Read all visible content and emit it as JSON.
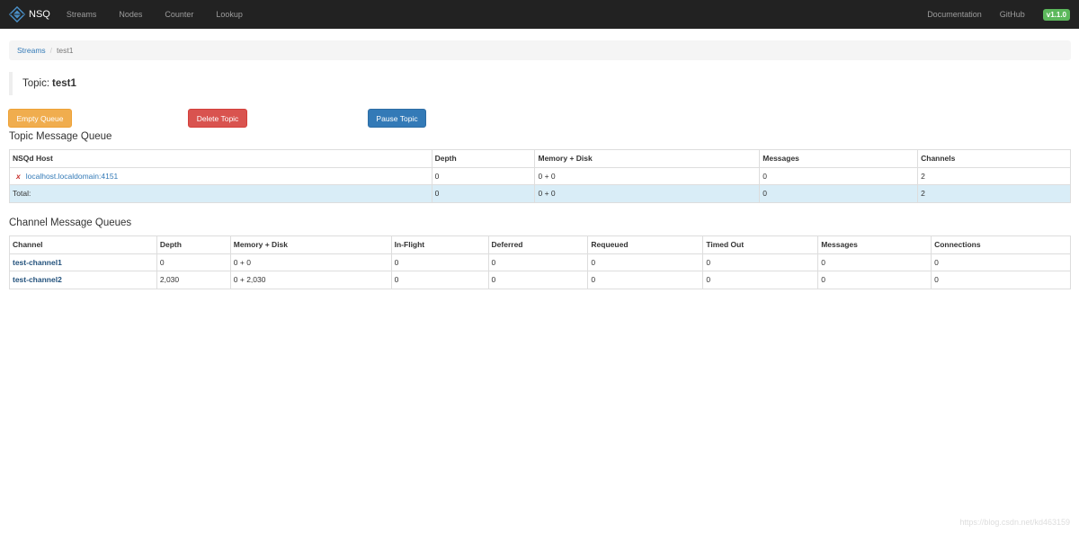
{
  "navbar": {
    "brand": "NSQ",
    "links": [
      "Streams",
      "Nodes",
      "Counter",
      "Lookup"
    ],
    "right_links": [
      "Documentation",
      "GitHub"
    ],
    "version": "v1.1.0"
  },
  "breadcrumb": {
    "parent": "Streams",
    "separator": "/",
    "current": "test1"
  },
  "topic": {
    "label": "Topic:",
    "name": "test1"
  },
  "buttons": {
    "empty_queue": "Empty Queue",
    "delete_topic": "Delete Topic",
    "pause_topic": "Pause Topic"
  },
  "topic_queue": {
    "title": "Topic Message Queue",
    "headers": [
      "NSQd Host",
      "Depth",
      "Memory + Disk",
      "Messages",
      "Channels"
    ],
    "host_row": {
      "host": "localhost.localdomain:4151",
      "depth": "0",
      "memory_disk": "0 + 0",
      "messages": "0",
      "channels": "2"
    },
    "total_row": {
      "label": "Total:",
      "depth": "0",
      "memory_disk": "0 + 0",
      "messages": "0",
      "channels": "2"
    }
  },
  "channel_queue": {
    "title": "Channel Message Queues",
    "headers": [
      "Channel",
      "Depth",
      "Memory + Disk",
      "In-Flight",
      "Deferred",
      "Requeued",
      "Timed Out",
      "Messages",
      "Connections"
    ],
    "rows": [
      {
        "channel": "test-channel1",
        "depth": "0",
        "memory_disk": "0 + 0",
        "in_flight": "0",
        "deferred": "0",
        "requeued": "0",
        "timed_out": "0",
        "messages": "0",
        "connections": "0"
      },
      {
        "channel": "test-channel2",
        "depth": "2,030",
        "memory_disk": "0 + 2,030",
        "in_flight": "0",
        "deferred": "0",
        "requeued": "0",
        "timed_out": "0",
        "messages": "0",
        "connections": "0"
      }
    ]
  },
  "watermark": "https://blog.csdn.net/kd463159",
  "colors": {
    "navbar_bg": "#222222",
    "link": "#337ab7",
    "warning": "#f0ad4e",
    "danger": "#d9534f",
    "primary": "#337ab7",
    "success_badge": "#5cb85c",
    "total_row_bg": "#d9edf7"
  },
  "icons": {
    "brand_logo": "nsq-logo-icon",
    "host_status": "x-mark-icon"
  }
}
